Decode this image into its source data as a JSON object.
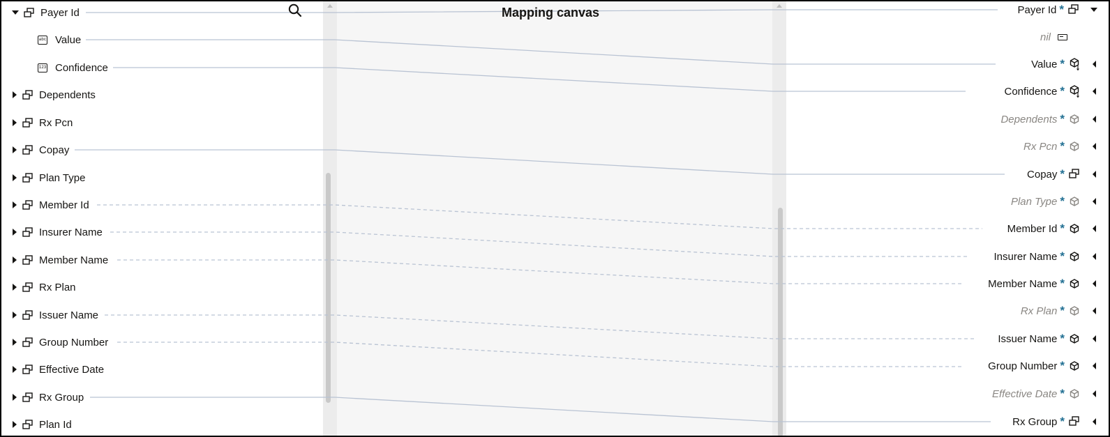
{
  "canvas": {
    "title": "Mapping canvas"
  },
  "colors": {
    "accent": "#227093",
    "line": "#b9c3d3",
    "muted": "#8a8783"
  },
  "source_fields": [
    {
      "label": "Payer Id",
      "type": "object",
      "expanded": true
    },
    {
      "label": "Value",
      "type": "text-leaf"
    },
    {
      "label": "Confidence",
      "type": "number-leaf"
    },
    {
      "label": "Dependents",
      "type": "object"
    },
    {
      "label": "Rx Pcn",
      "type": "object"
    },
    {
      "label": "Copay",
      "type": "object"
    },
    {
      "label": "Plan Type",
      "type": "object"
    },
    {
      "label": "Member Id",
      "type": "object"
    },
    {
      "label": "Insurer Name",
      "type": "object"
    },
    {
      "label": "Member Name",
      "type": "object"
    },
    {
      "label": "Rx Plan",
      "type": "object"
    },
    {
      "label": "Issuer Name",
      "type": "object"
    },
    {
      "label": "Group Number",
      "type": "object"
    },
    {
      "label": "Effective Date",
      "type": "object"
    },
    {
      "label": "Rx Group",
      "type": "object"
    },
    {
      "label": "Plan Id",
      "type": "object"
    }
  ],
  "target_fields": [
    {
      "label": "Payer Id",
      "required": "*",
      "icon": "object-icon",
      "expanded": true,
      "mapped": true
    },
    {
      "label": "nil",
      "icon": "nil-icon"
    },
    {
      "label": "Value",
      "required": "*",
      "icon": "mapped-variable-icon",
      "mapped": true
    },
    {
      "label": "Confidence",
      "required": "*",
      "icon": "mapped-variable-icon",
      "mapped": true
    },
    {
      "label": "Dependents",
      "required": "*",
      "icon": "cube-icon",
      "mapped": false
    },
    {
      "label": "Rx Pcn",
      "required": "*",
      "icon": "cube-icon",
      "mapped": false
    },
    {
      "label": "Copay",
      "required": "*",
      "icon": "object-icon",
      "mapped": true
    },
    {
      "label": "Plan Type",
      "required": "*",
      "icon": "cube-icon",
      "mapped": false
    },
    {
      "label": "Member Id",
      "required": "*",
      "icon": "cube-icon",
      "mapped": true
    },
    {
      "label": "Insurer Name",
      "required": "*",
      "icon": "cube-icon",
      "mapped": true
    },
    {
      "label": "Member Name",
      "required": "*",
      "icon": "cube-icon",
      "mapped": true
    },
    {
      "label": "Rx Plan",
      "required": "*",
      "icon": "cube-icon",
      "mapped": false
    },
    {
      "label": "Issuer Name",
      "required": "*",
      "icon": "cube-icon",
      "mapped": true
    },
    {
      "label": "Group Number",
      "required": "*",
      "icon": "cube-icon",
      "mapped": true
    },
    {
      "label": "Effective Date",
      "required": "*",
      "icon": "cube-icon",
      "mapped": false
    },
    {
      "label": "Rx Group",
      "required": "*",
      "icon": "object-icon",
      "mapped": true
    }
  ]
}
